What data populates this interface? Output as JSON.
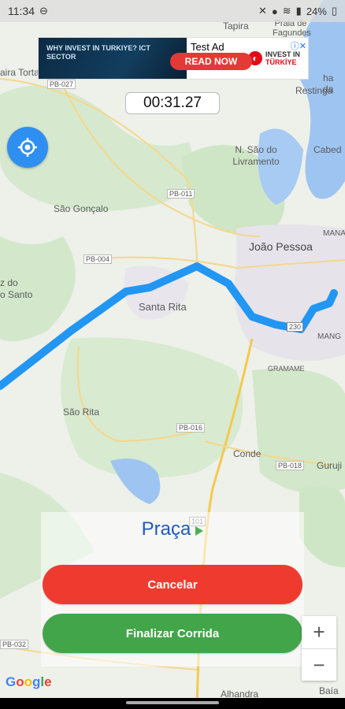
{
  "status_bar": {
    "time": "11:34",
    "battery": "24%"
  },
  "ad": {
    "label": "Test Ad",
    "cta": "READ NOW",
    "image_text": "WHY INVEST IN TURKIYE? ICT SECTOR",
    "brand_line1": "INVEST IN",
    "brand_line2": "TÜRKİYE"
  },
  "timer": {
    "value": "00:31.27"
  },
  "destination": {
    "name": "Praça"
  },
  "buttons": {
    "cancel": "Cancelar",
    "finish": "Finalizar Corrida"
  },
  "zoom": {
    "in": "+",
    "out": "−"
  },
  "map": {
    "labels": [
      {
        "id": "tapira",
        "text": "Tapira"
      },
      {
        "id": "praia-fagundes",
        "text": "Praia de Fagundes"
      },
      {
        "id": "aira-torta",
        "text": "aira Torta"
      },
      {
        "id": "pb027",
        "text": "PB-027"
      },
      {
        "id": "restinga",
        "text": "Restinga"
      },
      {
        "id": "ha-da",
        "text": "ha da"
      },
      {
        "id": "nsao-livramento",
        "text": "N. São do Livramento"
      },
      {
        "id": "cabedelo",
        "text": "Cabed"
      },
      {
        "id": "pb011",
        "text": "PB-011"
      },
      {
        "id": "sao-goncalo",
        "text": "São Gonçalo"
      },
      {
        "id": "joao-pessoa",
        "text": "João Pessoa"
      },
      {
        "id": "pb004",
        "text": "PB-004"
      },
      {
        "id": "z-do",
        "text": "z do"
      },
      {
        "id": "o-santo",
        "text": "o Santo"
      },
      {
        "id": "santa-rita",
        "text": "Santa Rita"
      },
      {
        "id": "mana",
        "text": "MANA"
      },
      {
        "id": "br230",
        "text": "230"
      },
      {
        "id": "mang",
        "text": "MANG"
      },
      {
        "id": "gramame",
        "text": "GRAMAME"
      },
      {
        "id": "sao-rita",
        "text": "São Rita"
      },
      {
        "id": "pb016",
        "text": "PB-016"
      },
      {
        "id": "conde",
        "text": "Conde"
      },
      {
        "id": "pb018",
        "text": "PB-018"
      },
      {
        "id": "guruji",
        "text": "Guruji"
      },
      {
        "id": "br101",
        "text": "101"
      },
      {
        "id": "pb032",
        "text": "PB-032"
      },
      {
        "id": "alhandra",
        "text": "Alhandra"
      },
      {
        "id": "baia-da",
        "text": "Baía da"
      }
    ]
  },
  "colors": {
    "route": "#2196f3",
    "cancel": "#ef3b2f",
    "finish": "#43a54a",
    "accent": "#2f8ff0"
  },
  "icons": [
    "my-location-icon",
    "play-arrow-icon",
    "ad-close-icon"
  ]
}
